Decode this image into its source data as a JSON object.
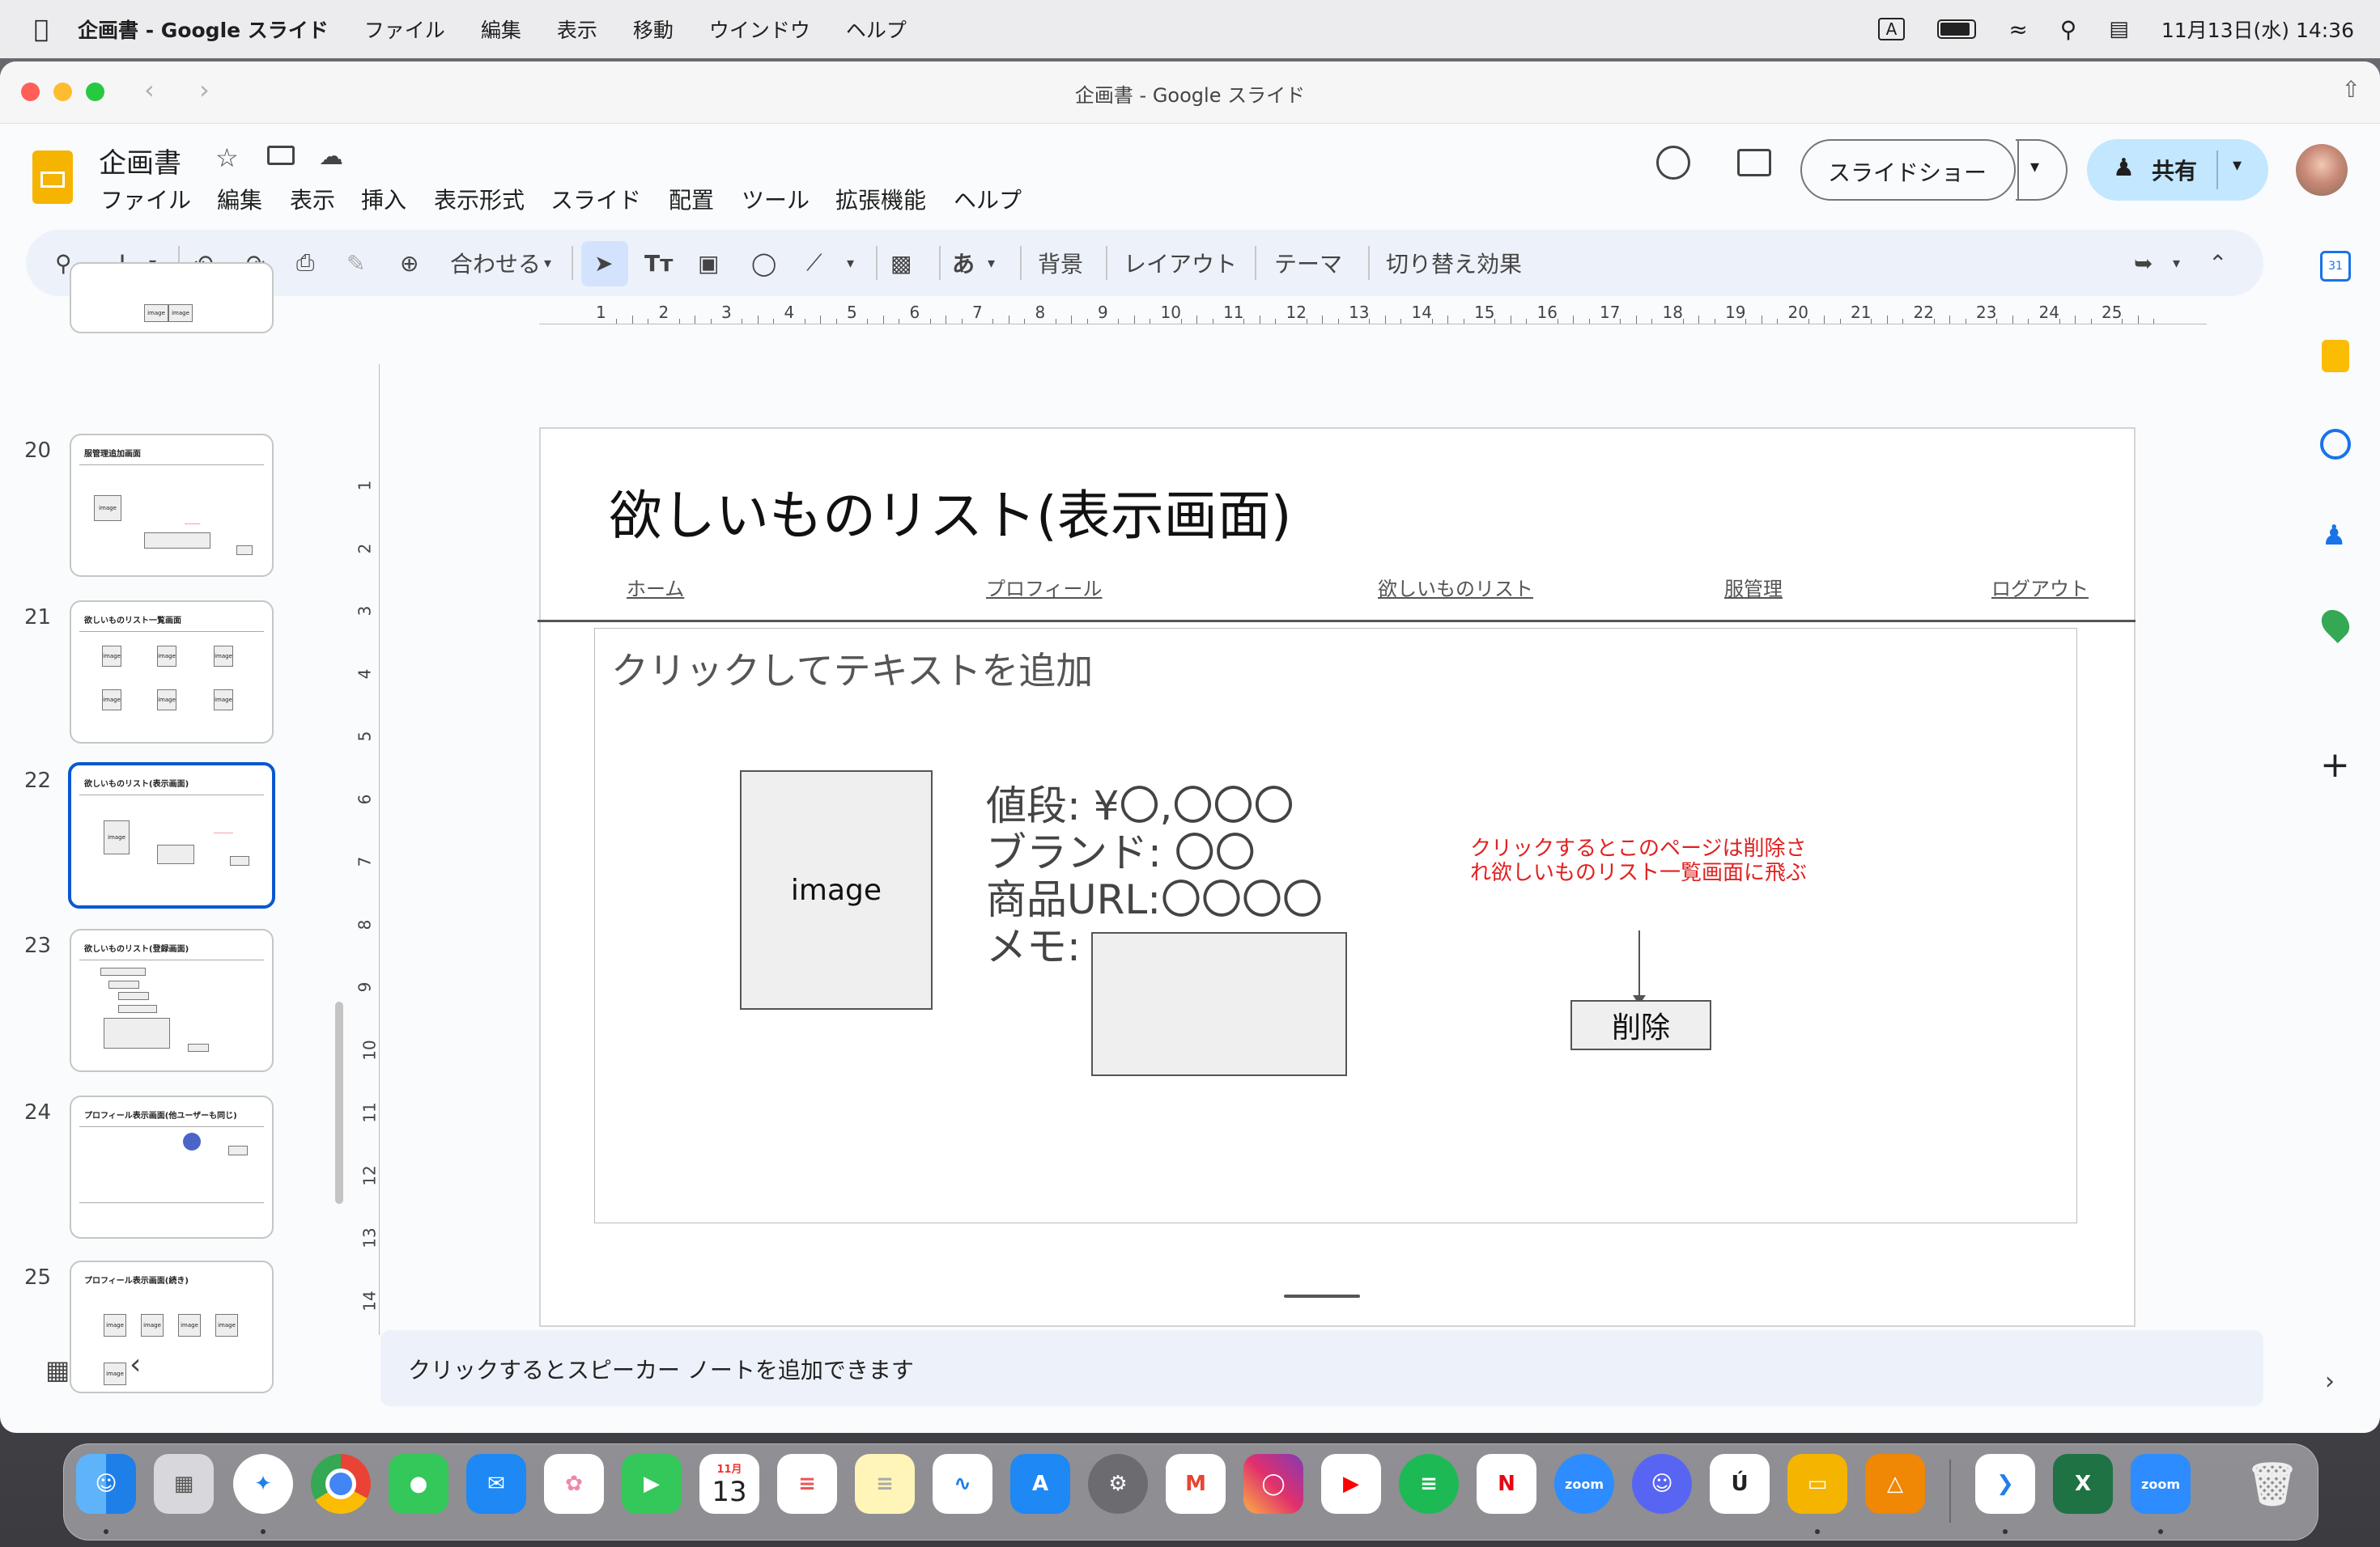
{
  "menubar": {
    "app": "企画書 - Google スライド",
    "items": [
      "ファイル",
      "編集",
      "表示",
      "移動",
      "ウインドウ",
      "ヘルプ"
    ],
    "input_mode": "A",
    "clock": "11月13日(水) 14:36"
  },
  "window": {
    "title": "企画書 - Google スライド"
  },
  "doc": {
    "title": "企画書",
    "menus": [
      "ファイル",
      "編集",
      "表示",
      "挿入",
      "表示形式",
      "スライド",
      "配置",
      "ツール",
      "拡張機能",
      "ヘルプ"
    ],
    "slideshow_label": "スライドショー",
    "share_label": "共有"
  },
  "toolbar": {
    "zoom_label": "合わせる",
    "font_label": "あ",
    "background": "背景",
    "layout": "レイアウト",
    "theme": "テーマ",
    "transition": "切り替え効果"
  },
  "ruler": {
    "h": [
      "1",
      "2",
      "3",
      "4",
      "5",
      "6",
      "7",
      "8",
      "9",
      "10",
      "11",
      "12",
      "13",
      "14",
      "15",
      "16",
      "17",
      "18",
      "19",
      "20",
      "21",
      "22",
      "23",
      "24",
      "25"
    ],
    "v": [
      "1",
      "2",
      "3",
      "4",
      "5",
      "6",
      "7",
      "8",
      "9",
      "10",
      "11",
      "12",
      "13",
      "14"
    ]
  },
  "filmstrip": [
    {
      "num": "20",
      "title": "服管理追加画面"
    },
    {
      "num": "21",
      "title": "欲しいものリスト一覧画面"
    },
    {
      "num": "22",
      "title": "欲しいものリスト(表示画面)",
      "selected": true
    },
    {
      "num": "23",
      "title": "欲しいものリスト(登録画面)"
    },
    {
      "num": "24",
      "title": "プロフィール表示画面(他ユーザーも同じ)"
    },
    {
      "num": "25",
      "title": "プロフィール表示画面(続き)"
    }
  ],
  "slide": {
    "title": "欲しいものリスト(表示画面)",
    "nav": [
      "ホーム",
      "プロフィール",
      "欲しいものリスト",
      "服管理",
      "ログアウト"
    ],
    "placeholder": "クリックしてテキストを追加",
    "image_label": "image",
    "price": "値段: ¥〇,〇〇〇",
    "brand": "ブランド: 〇〇",
    "url": "商品URL:〇〇〇〇",
    "memo": "メモ:",
    "note": "クリックするとこのページは削除され欲しいものリスト一覧画面に飛ぶ",
    "delete_button": "削除"
  },
  "speaker_notes": {
    "placeholder": "クリックするとスピーカー ノートを追加できます"
  },
  "colors": {
    "accent": "#0b57d0",
    "share_bg": "#c2e7ff",
    "toolbar_bg": "#edf2fa",
    "note_red": "#e02020",
    "slides_yellow": "#f4b400"
  },
  "dock": [
    "finder",
    "launchpad",
    "safari",
    "chrome",
    "messages",
    "mail",
    "photos",
    "facetime",
    "calendar",
    "reminders",
    "notes",
    "freeform",
    "app-store",
    "system-settings",
    "gmail",
    "instagram",
    "youtube",
    "spotify",
    "netflix",
    "zoom",
    "discord",
    "udemy",
    "slides",
    "drawio",
    "vscode",
    "excel",
    "zoom",
    "trash"
  ],
  "dock_calendar": {
    "month": "11月",
    "day": "13"
  },
  "dock_zoom_label": "zoom"
}
